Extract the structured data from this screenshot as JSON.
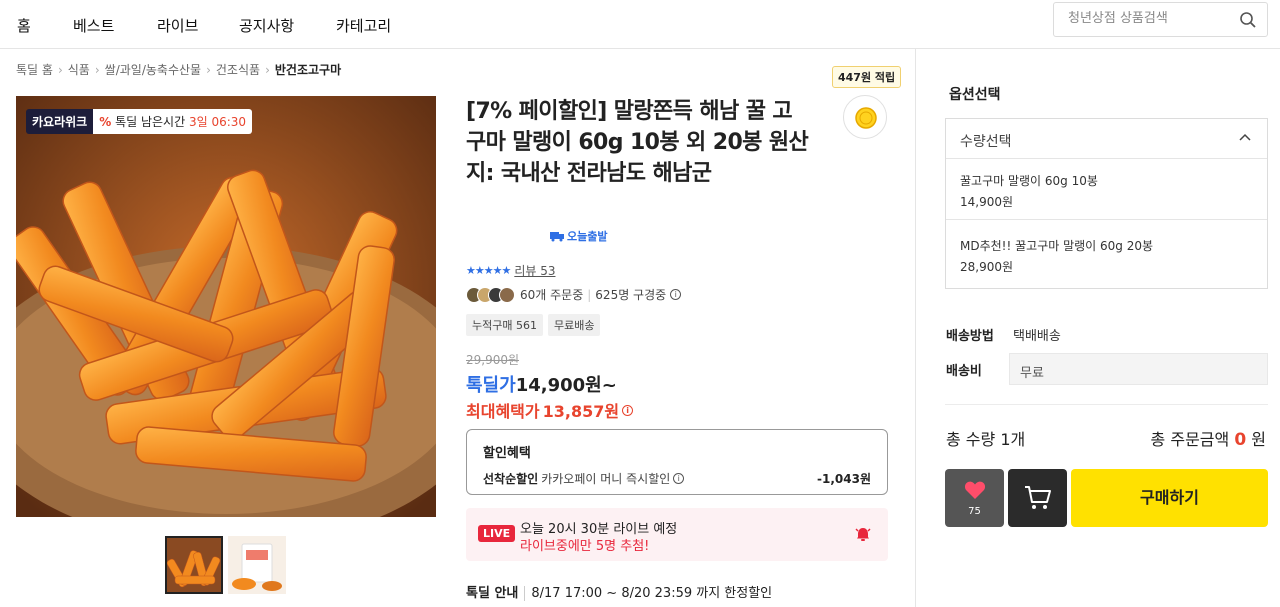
{
  "nav": {
    "items": [
      "홈",
      "베스트",
      "라이브",
      "공지사항",
      "카테고리"
    ],
    "search_placeholder": "청년상점 상품검색"
  },
  "breadcrumb": [
    "톡딜 홈",
    "식품",
    "쌀/과일/농축수산물",
    "건조식품",
    "반건조고구마"
  ],
  "image_badge": {
    "brand": "카요라위크",
    "timer_label": "톡딜 남은시간",
    "timer_value": "3일 06:30"
  },
  "product": {
    "title": "[7% 페이할인] 말랑쫀득 해남 꿀 고구마 말랭이 60g 10봉 외 20봉 원산지: 국내산 전라남도 해남군",
    "delivery_tag": "오늘출발",
    "points": "447원 적립",
    "rating_stars": "★★★★★",
    "reviews": "리뷰 53",
    "orders": "60개 주문중",
    "buyers": "625명 구경중",
    "chips": [
      "누적구매 561",
      "무료배송"
    ],
    "original_price": "29,900원",
    "deal_label": "톡딜가",
    "deal_price": "14,900원~",
    "max_label": "최대혜택가",
    "max_price": "13,857원"
  },
  "discount": {
    "heading": "할인혜택",
    "type": "선착순할인",
    "desc": "카카오페이 머니 즉시할인",
    "amount": "-1,043원"
  },
  "live": {
    "badge": "LIVE",
    "line1": "오늘 20시 30분 라이브 예정",
    "line2": "라이브중에만 5명 추첨!"
  },
  "notice": {
    "label": "톡딜 안내",
    "text": "8/17 17:00 ~ 8/20 23:59 까지 한정할인"
  },
  "options": {
    "title": "옵션선택",
    "select_label": "수량선택",
    "items": [
      {
        "name": "꿀고구마 말랭이 60g 10봉",
        "price": "14,900원"
      },
      {
        "name": "MD추천!! 꿀고구마 말랭이 60g 20봉",
        "price": "28,900원"
      }
    ]
  },
  "shipping": {
    "method_label": "배송방법",
    "method_value": "택배배송",
    "fee_label": "배송비",
    "fee_value": "무료"
  },
  "totals": {
    "qty_text": "총 수량 1개",
    "amount_label": "총 주문금액",
    "amount_value": "0",
    "amount_unit": "원"
  },
  "actions": {
    "like_count": "75",
    "buy_label": "구매하기"
  },
  "colors": {
    "accent_blue": "#2f6fe4",
    "accent_red": "#e8442e",
    "buy_yellow": "#ffe100"
  }
}
